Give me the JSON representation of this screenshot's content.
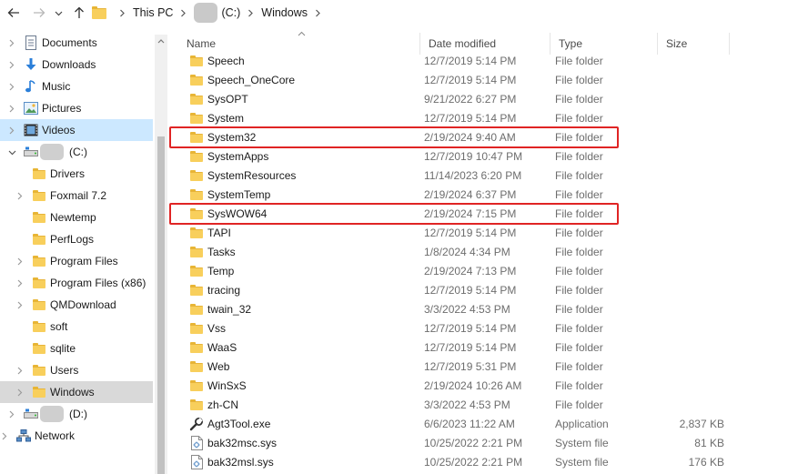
{
  "address": {
    "breadcrumbs": [
      "This PC",
      "(C:)",
      "Windows"
    ]
  },
  "nav": {
    "items": [
      {
        "label": "Documents",
        "icon": "documents-icon",
        "depth": 1,
        "chevron": true
      },
      {
        "label": "Downloads",
        "icon": "downloads-icon",
        "depth": 1,
        "chevron": true
      },
      {
        "label": "Music",
        "icon": "music-icon",
        "depth": 1,
        "chevron": true
      },
      {
        "label": "Pictures",
        "icon": "pictures-icon",
        "depth": 1,
        "chevron": true
      },
      {
        "label": "Videos",
        "icon": "videos-icon",
        "depth": 1,
        "chevron": true,
        "state": "selected"
      },
      {
        "label": "(C:)",
        "icon": "drive-icon",
        "depth": 1,
        "chevron": "open"
      },
      {
        "label": "Drivers",
        "icon": "folder-icon",
        "depth": 2,
        "chevron": false
      },
      {
        "label": "Foxmail 7.2",
        "icon": "folder-icon",
        "depth": 2,
        "chevron": true
      },
      {
        "label": "Newtemp",
        "icon": "folder-icon",
        "depth": 2,
        "chevron": false
      },
      {
        "label": "PerfLogs",
        "icon": "folder-icon",
        "depth": 2,
        "chevron": false
      },
      {
        "label": "Program Files",
        "icon": "folder-icon",
        "depth": 2,
        "chevron": true
      },
      {
        "label": "Program Files (x86)",
        "icon": "folder-icon",
        "depth": 2,
        "chevron": true
      },
      {
        "label": "QMDownload",
        "icon": "folder-icon",
        "depth": 2,
        "chevron": true
      },
      {
        "label": "soft",
        "icon": "folder-icon",
        "depth": 2,
        "chevron": false
      },
      {
        "label": "sqlite",
        "icon": "folder-icon",
        "depth": 2,
        "chevron": false
      },
      {
        "label": "Users",
        "icon": "folder-icon",
        "depth": 2,
        "chevron": true
      },
      {
        "label": "Windows",
        "icon": "folder-icon",
        "depth": 2,
        "chevron": true,
        "state": "current"
      },
      {
        "label": "(D:)",
        "icon": "drive-icon",
        "depth": 1,
        "chevron": true
      },
      {
        "label": "Network",
        "icon": "network-icon",
        "depth": 0,
        "chevron": true
      }
    ]
  },
  "columns": {
    "name": "Name",
    "date": "Date modified",
    "type": "Type",
    "size": "Size"
  },
  "files": [
    {
      "name": "Speech",
      "date": "12/7/2019 5:14 PM",
      "type": "File folder",
      "size": "",
      "icon": "folder-icon"
    },
    {
      "name": "Speech_OneCore",
      "date": "12/7/2019 5:14 PM",
      "type": "File folder",
      "size": "",
      "icon": "folder-icon"
    },
    {
      "name": "SysOPT",
      "date": "9/21/2022 6:27 PM",
      "type": "File folder",
      "size": "",
      "icon": "folder-icon"
    },
    {
      "name": "System",
      "date": "12/7/2019 5:14 PM",
      "type": "File folder",
      "size": "",
      "icon": "folder-icon"
    },
    {
      "name": "System32",
      "date": "2/19/2024 9:40 AM",
      "type": "File folder",
      "size": "",
      "icon": "folder-icon",
      "highlight": true
    },
    {
      "name": "SystemApps",
      "date": "12/7/2019 10:47 PM",
      "type": "File folder",
      "size": "",
      "icon": "folder-icon"
    },
    {
      "name": "SystemResources",
      "date": "11/14/2023 6:20 PM",
      "type": "File folder",
      "size": "",
      "icon": "folder-icon"
    },
    {
      "name": "SystemTemp",
      "date": "2/19/2024 6:37 PM",
      "type": "File folder",
      "size": "",
      "icon": "folder-icon"
    },
    {
      "name": "SysWOW64",
      "date": "2/19/2024 7:15 PM",
      "type": "File folder",
      "size": "",
      "icon": "folder-icon",
      "highlight": true
    },
    {
      "name": "TAPI",
      "date": "12/7/2019 5:14 PM",
      "type": "File folder",
      "size": "",
      "icon": "folder-icon"
    },
    {
      "name": "Tasks",
      "date": "1/8/2024 4:34 PM",
      "type": "File folder",
      "size": "",
      "icon": "folder-icon"
    },
    {
      "name": "Temp",
      "date": "2/19/2024 7:13 PM",
      "type": "File folder",
      "size": "",
      "icon": "folder-icon"
    },
    {
      "name": "tracing",
      "date": "12/7/2019 5:14 PM",
      "type": "File folder",
      "size": "",
      "icon": "folder-icon"
    },
    {
      "name": "twain_32",
      "date": "3/3/2022 4:53 PM",
      "type": "File folder",
      "size": "",
      "icon": "folder-icon"
    },
    {
      "name": "Vss",
      "date": "12/7/2019 5:14 PM",
      "type": "File folder",
      "size": "",
      "icon": "folder-icon"
    },
    {
      "name": "WaaS",
      "date": "12/7/2019 5:14 PM",
      "type": "File folder",
      "size": "",
      "icon": "folder-icon"
    },
    {
      "name": "Web",
      "date": "12/7/2019 5:31 PM",
      "type": "File folder",
      "size": "",
      "icon": "folder-icon"
    },
    {
      "name": "WinSxS",
      "date": "2/19/2024 10:26 AM",
      "type": "File folder",
      "size": "",
      "icon": "folder-icon"
    },
    {
      "name": "zh-CN",
      "date": "3/3/2022 4:53 PM",
      "type": "File folder",
      "size": "",
      "icon": "folder-icon"
    },
    {
      "name": "Agt3Tool.exe",
      "date": "6/6/2023 11:22 AM",
      "type": "Application",
      "size": "2,837 KB",
      "icon": "wrench-app-icon"
    },
    {
      "name": "bak32msc.sys",
      "date": "10/25/2022 2:21 PM",
      "type": "System file",
      "size": "81 KB",
      "icon": "system-file-icon"
    },
    {
      "name": "bak32msl.sys",
      "date": "10/25/2022 2:21 PM",
      "type": "System file",
      "size": "176 KB",
      "icon": "system-file-icon"
    }
  ],
  "colors": {
    "selected_bg": "#cce8ff",
    "current_bg": "#d9d9d9",
    "highlight_border": "#e02424",
    "folder": "#f8cf5c"
  }
}
